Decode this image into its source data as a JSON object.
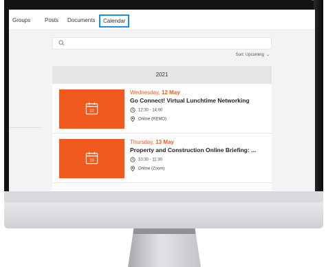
{
  "nav": {
    "items": [
      {
        "label": "Groups"
      },
      {
        "label": "Posts"
      },
      {
        "label": "Documents"
      },
      {
        "label": "Calendar",
        "active": true
      }
    ]
  },
  "search": {
    "placeholder": ""
  },
  "sort": {
    "label": "Sort: Upcoming"
  },
  "year": "2021",
  "events": [
    {
      "weekday": "Wednesday,",
      "date": "12 May",
      "day_number": "12",
      "title": "Go Connect! Virtual Lunchtime Networking",
      "time": "12:30 - 14:00",
      "location": "Online (REMO)"
    },
    {
      "weekday": "Thursday,",
      "date": "13 May",
      "day_number": "13",
      "title": "Property and Construction Online Briefing: ...",
      "time": "10:30 - 11:30",
      "location": "Online (Zoom)"
    }
  ],
  "colors": {
    "accent": "#f05a1e",
    "active_outline": "#1a8fe0"
  }
}
